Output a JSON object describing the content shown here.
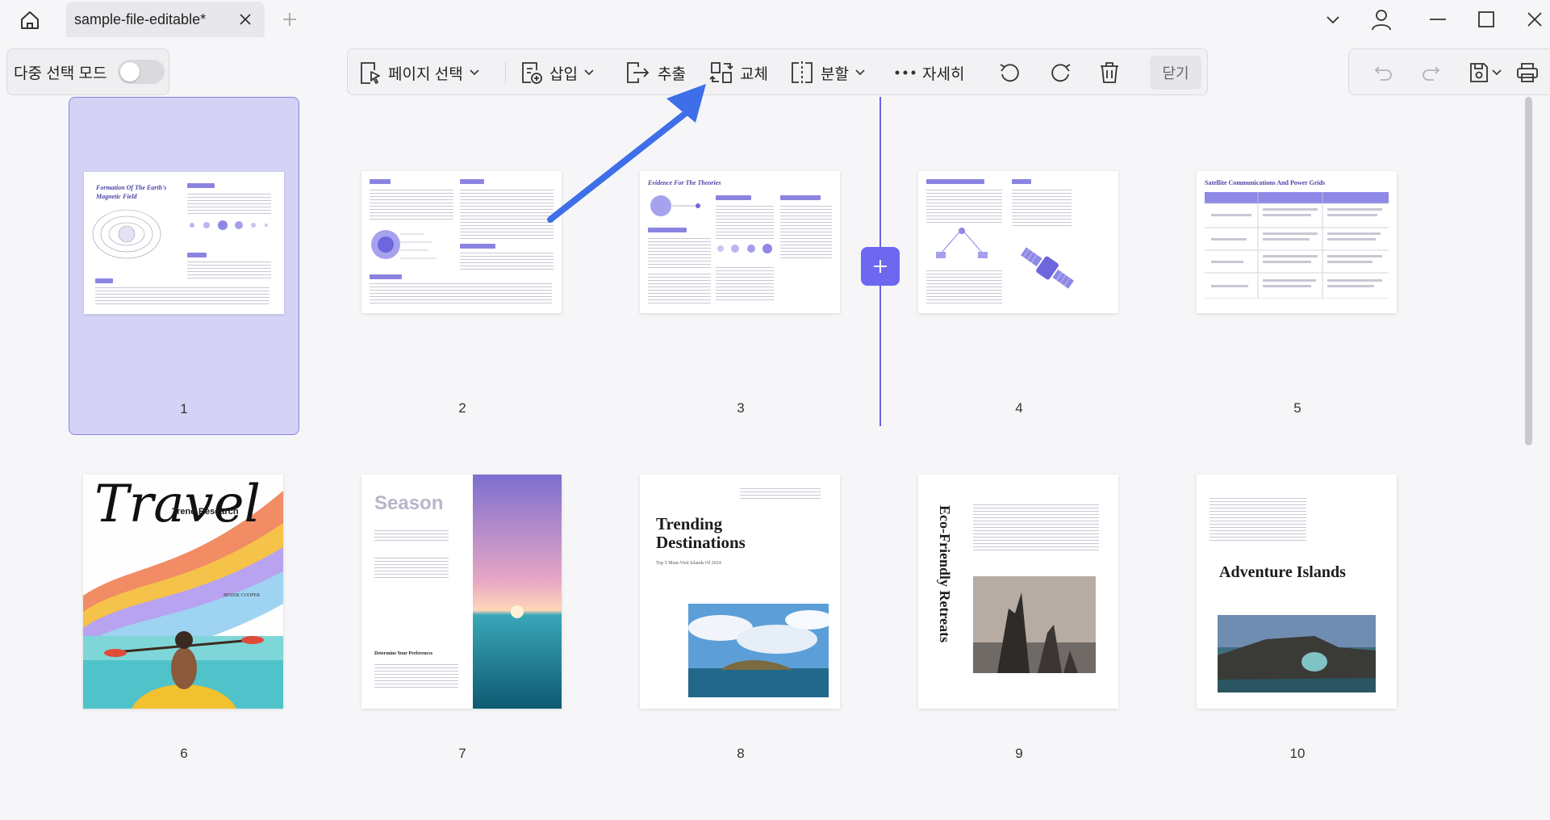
{
  "titlebar": {
    "tab_title": "sample-file-editable*"
  },
  "toolbar": {
    "multi_select_label": "다중 선택 모드",
    "page_select_label": "페이지 선택",
    "insert_label": "삽입",
    "extract_label": "추출",
    "replace_label": "교체",
    "split_label": "분할",
    "more_label": "자세히",
    "close_label": "닫기"
  },
  "pages": [
    {
      "number": "1",
      "heading": "Formation Of The Earth's Magnetic Field"
    },
    {
      "number": "2"
    },
    {
      "number": "3",
      "heading": "Evidence For The Theories"
    },
    {
      "number": "4"
    },
    {
      "number": "5",
      "heading": "Satellite Communications And Power Grids"
    },
    {
      "number": "6",
      "heading": "Travel",
      "subheading": "Trend Research",
      "author": "BESSIE COOPER"
    },
    {
      "number": "7",
      "heading": "Season",
      "subheading": "Determine Your Preferences"
    },
    {
      "number": "8",
      "heading": "Trending Destinations",
      "subheading": "Top 5 Must-Visit Islands Of 2024"
    },
    {
      "number": "9",
      "heading": "Eco-Friendly Retreats"
    },
    {
      "number": "10",
      "heading": "Adventure Islands"
    }
  ],
  "colors": {
    "accent": "#6e67f0",
    "selected_bg": "#d4d2f5",
    "annotation_arrow": "#3e6fe8"
  }
}
